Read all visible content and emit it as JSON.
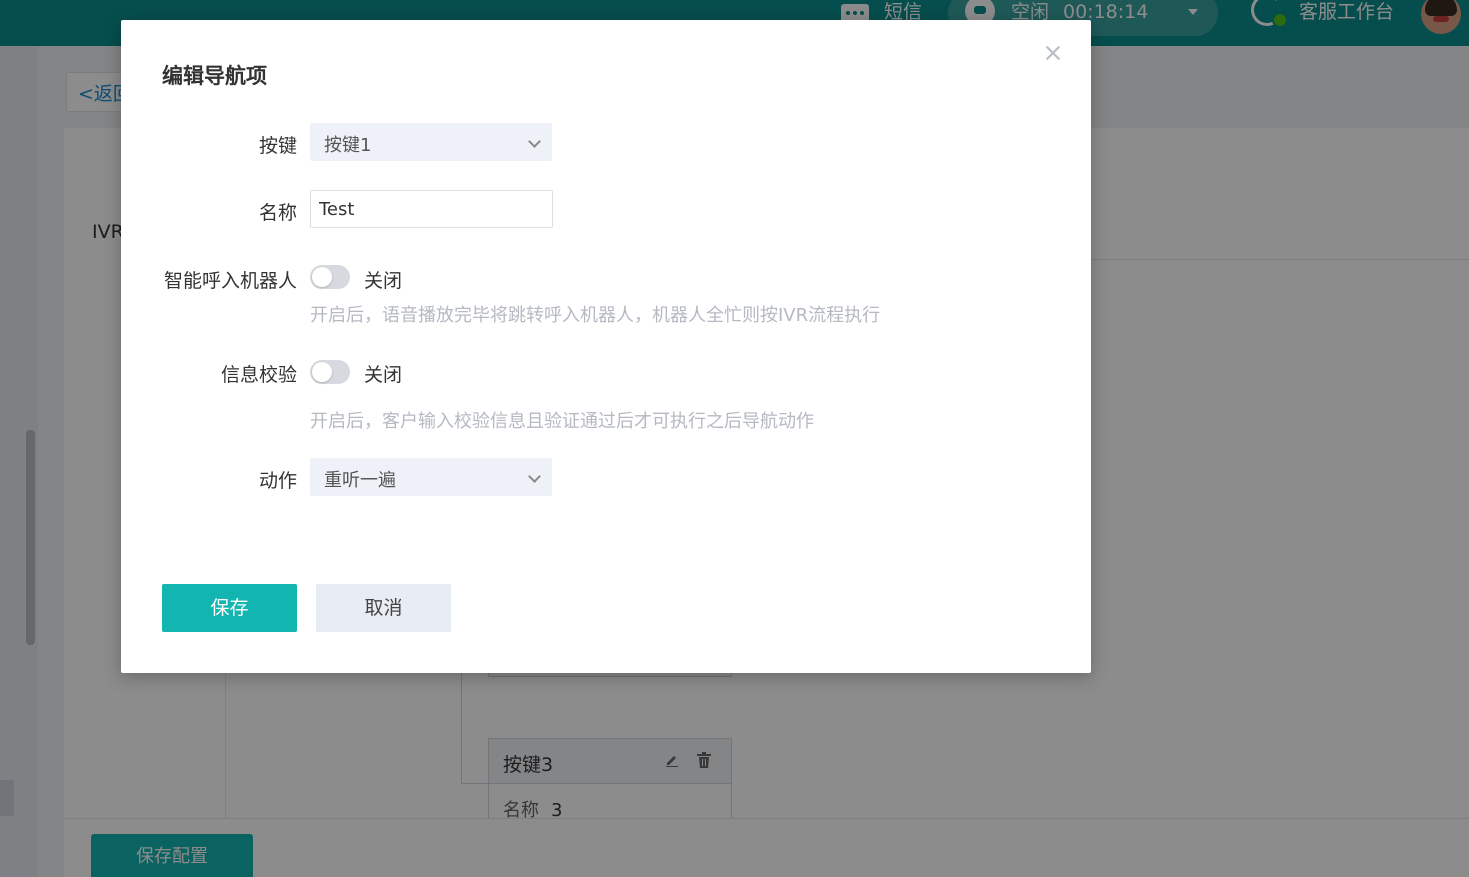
{
  "topbar": {
    "sms_label": "短信",
    "status_label": "空闲",
    "timer": "00:18:14",
    "workspace_label": "客服工作台"
  },
  "page": {
    "back_label": "<返回",
    "ivr_label": "IVR",
    "save_config_label": "保存配置"
  },
  "tree": {
    "card_title": "按键3",
    "card_name_label": "名称",
    "card_name_value": "3"
  },
  "modal": {
    "title": "编辑导航项",
    "key_label": "按键",
    "key_value": "按键1",
    "name_label": "名称",
    "name_value": "Test",
    "robot_label": "智能呼入机器人",
    "robot_state": "关闭",
    "robot_hint": "开启后，语音播放完毕将跳转呼入机器人，机器人全忙则按IVR流程执行",
    "verify_label": "信息校验",
    "verify_state": "关闭",
    "verify_hint": "开启后，客户输入校验信息且验证通过后才可执行之后导航动作",
    "action_label": "动作",
    "action_value": "重听一遍",
    "save_label": "保存",
    "cancel_label": "取消"
  },
  "colors": {
    "brand": "#0b8f8d",
    "primary_button": "#13b5b1",
    "mask": "rgba(0,0,0,0.45)"
  }
}
